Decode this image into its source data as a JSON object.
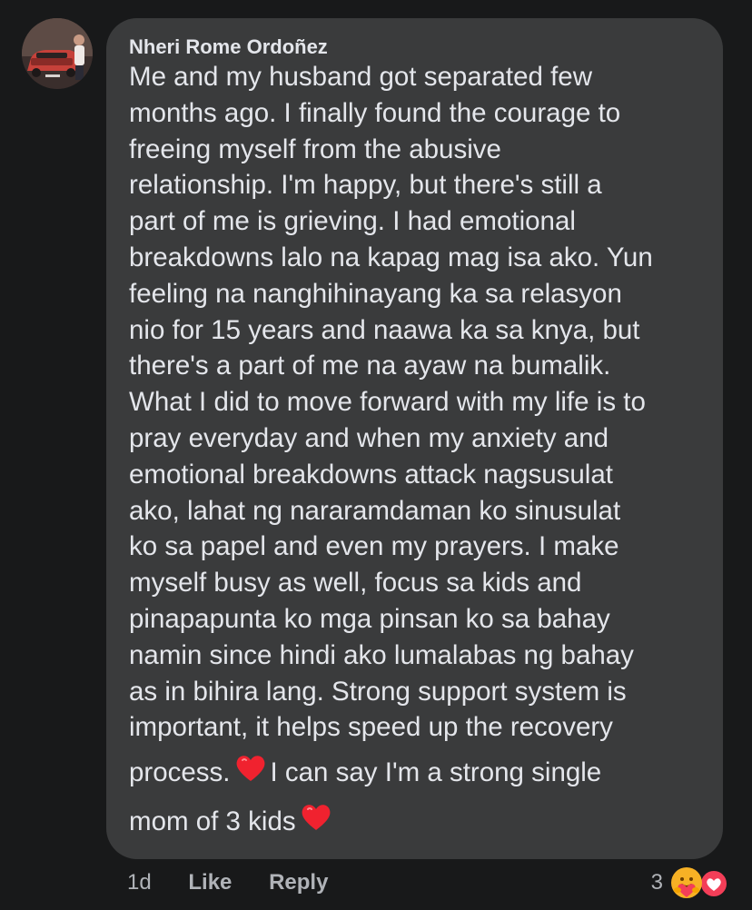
{
  "comment": {
    "author": "Nheri Rome Ordoñez",
    "body_lines": [
      "Me and my husband got separated few",
      "months ago. I finally found the courage to",
      "freeing myself from the abusive",
      "relationship. I'm happy, but there's still a",
      "part of me is grieving. I had emotional",
      "breakdowns lalo na kapag mag isa ako. Yun",
      "feeling na nanghihinayang ka sa relasyon",
      "nio for 15 years and naawa ka sa knya, but",
      "there's a part of me na ayaw na bumalik.",
      "What I did to move forward with my life is to",
      "pray everyday and when my anxiety and",
      "emotional breakdowns attack nagsusulat",
      "ako, lahat  ng nararamdaman ko sinusulat",
      "ko sa papel and even my prayers. I make",
      "myself busy as well, focus sa kids and",
      "pinapapunta ko mga pinsan ko sa bahay",
      "namin since hindi ako lumalabas ng bahay",
      "as in bihira lang. Strong support system is",
      "important, it helps speed up the recovery"
    ],
    "line20_before_heart": "process.",
    "line20_after_heart": "I can say I'm a strong single",
    "line21_text": "mom of 3 kids",
    "heart_emoji_icon": "red-heart-icon",
    "avatar_icon": "user-avatar"
  },
  "actions": {
    "time": "1d",
    "like_label": "Like",
    "reply_label": "Reply"
  },
  "reactions": {
    "count": "3",
    "icons": [
      "care-reaction-icon",
      "love-reaction-icon"
    ],
    "love_color": "#f33e58",
    "care_color": "#f7b125"
  },
  "colors": {
    "page_bg": "#18191a",
    "bubble_bg": "#3a3b3c",
    "primary_text": "#e4e6eb",
    "secondary_text": "#b0b3b8"
  }
}
